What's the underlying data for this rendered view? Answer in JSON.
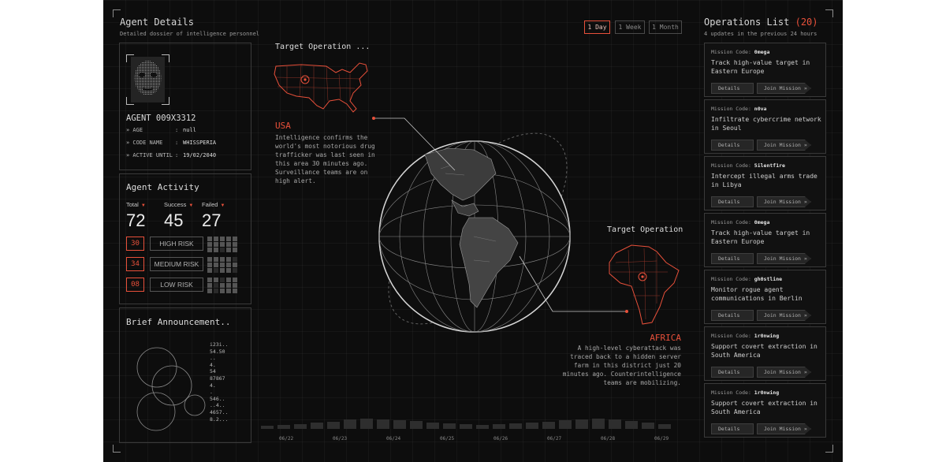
{
  "agent_details": {
    "title": "Agent Details",
    "subtitle": "Detailed dossier of intelligence personnel",
    "agent_id": "AGENT 009X3312",
    "fields": [
      {
        "key": "AGE",
        "value": "null"
      },
      {
        "key": "CODE NAME",
        "value": "WHISSPERIA"
      },
      {
        "key": "ACTIVE UNTIL",
        "value": "19/02/2040"
      }
    ]
  },
  "timeframe": {
    "options": [
      "1 Day",
      "1 Week",
      "1 Month"
    ],
    "selected": "1 Day"
  },
  "activity": {
    "title": "Agent Activity",
    "stats": [
      {
        "label": "Total",
        "value": "72"
      },
      {
        "label": "Success",
        "value": "45"
      },
      {
        "label": "Failed",
        "value": "27"
      }
    ],
    "risks": [
      {
        "count": "30",
        "label": "HIGH RISK"
      },
      {
        "count": "34",
        "label": "MEDIUM RISK"
      },
      {
        "count": "08",
        "label": "LOW RISK"
      }
    ]
  },
  "announcement": {
    "title": "Brief Announcement..",
    "numbers": [
      "i23i..",
      "54.50",
      "..",
      "4.",
      "54",
      "87867",
      "4.",
      ".",
      "546..",
      "..4..",
      "4657..",
      "8.2..."
    ]
  },
  "map": {
    "usa": {
      "header": "Target Operation ...",
      "name": "USA",
      "text": "Intelligence confirms the world's most notorious drug trafficker was last seen in this area 30 minutes ago. Surveillance teams are on high alert."
    },
    "africa": {
      "header": "Target Operation",
      "name": "AFRICA",
      "text": "A high-level cyberattack was traced back to a hidden server farm in this district just 20 minutes ago. Counterintelligence teams are mobilizing."
    },
    "timeline_dates": [
      "06/22",
      "06/23",
      "06/24",
      "06/25",
      "06/26",
      "06/27",
      "06/28",
      "06/29"
    ],
    "timeline_values": [
      1,
      2,
      3,
      5,
      6,
      9,
      10,
      9,
      8,
      7,
      5,
      4,
      3,
      2,
      3,
      4,
      5,
      6,
      8,
      9,
      10,
      9,
      7,
      5,
      3
    ]
  },
  "operations": {
    "title": "Operations List",
    "count": "(20)",
    "subtitle": "4 updates in the previous 24 hours",
    "code_label": "Mission Code:",
    "details_label": "Details",
    "join_label": "Join Mission »",
    "items": [
      {
        "code": "0mega",
        "text": "Track high-value target in Eastern Europe"
      },
      {
        "code": "n0va",
        "text": "Infiltrate cybercrime network in Seoul"
      },
      {
        "code": "5ilentf1re",
        "text": "Intercept illegal arms trade in Libya"
      },
      {
        "code": "0mega",
        "text": "Track high-value target in Eastern Europe"
      },
      {
        "code": "gh0stline",
        "text": "Monitor rogue agent communications in Berlin"
      },
      {
        "code": "1r0nwing",
        "text": "Support covert extraction in South America"
      },
      {
        "code": "1r0nwing",
        "text": "Support covert extraction in South America"
      }
    ]
  },
  "colors": {
    "accent": "#e8503a",
    "background": "#0d0d0d",
    "panel_border": "#3a3a3a"
  }
}
